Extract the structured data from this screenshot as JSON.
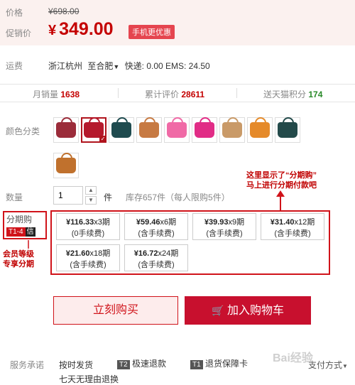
{
  "price": {
    "label_price": "价格",
    "original": "¥698.00",
    "label_promo": "促销价",
    "currency": "¥",
    "current": "349.00",
    "mobile_badge": "手机更优惠"
  },
  "shipping": {
    "label": "运费",
    "from": "浙江杭州",
    "to_prefix": "至",
    "to": "合肥",
    "detail": "快递: 0.00 EMS: 24.50"
  },
  "stats": {
    "monthly_label": "月销量",
    "monthly_value": "1638",
    "reviews_label": "累计评价",
    "reviews_value": "28611",
    "points_label": "送天猫积分",
    "points_value": "174"
  },
  "colors": {
    "label": "颜色分类",
    "swatches": [
      {
        "name": "wine-bag",
        "color": "#9b2c3a"
      },
      {
        "name": "red-bag",
        "color": "#b5192c"
      },
      {
        "name": "teal-bag",
        "color": "#1f4b4f"
      },
      {
        "name": "tan-bag",
        "color": "#c77a43"
      },
      {
        "name": "pink-bag",
        "color": "#f06aa6"
      },
      {
        "name": "rose-bag",
        "color": "#e12c86"
      },
      {
        "name": "camel-bag",
        "color": "#c99a68"
      },
      {
        "name": "orange-bag",
        "color": "#e58a2a"
      },
      {
        "name": "dark-teal-bag",
        "color": "#234a4a"
      },
      {
        "name": "brown-bag",
        "color": "#c0712d"
      }
    ]
  },
  "quantity": {
    "label": "数量",
    "value": "1",
    "unit": "件",
    "stock": "库存657件（每人限购5件）"
  },
  "installment": {
    "label": "分期购",
    "tag": "T1-4",
    "tag2": "信",
    "options": [
      {
        "price": "¥116.33",
        "period": "x3期",
        "fee": "(0手续费)"
      },
      {
        "price": "¥59.46",
        "period": "x6期",
        "fee": "(含手续费)"
      },
      {
        "price": "¥39.93",
        "period": "x9期",
        "fee": "(含手续费)"
      },
      {
        "price": "¥31.40",
        "period": "x12期",
        "fee": "(含手续费)"
      },
      {
        "price": "¥21.60",
        "period": "x18期",
        "fee": "(含手续费)"
      },
      {
        "price": "¥16.72",
        "period": "x24期",
        "fee": "(含手续费)"
      }
    ]
  },
  "annotations": {
    "top_right_line1": "这里显示了“分期购”",
    "top_right_line2": "马上进行分期付款吧",
    "left_line1": "会员等级",
    "left_line2": "专享分期"
  },
  "actions": {
    "buy_now": "立刻购买",
    "add_to_cart": "加入购物车"
  },
  "service": {
    "label": "服务承诺",
    "item1": "按时发货",
    "tag2": "T2",
    "item2": "极速退款",
    "tag3": "T1",
    "item3": "退货保障卡",
    "item4": "七天无理由退换",
    "payment": "支付方式",
    "watermark": "Bai经验"
  }
}
